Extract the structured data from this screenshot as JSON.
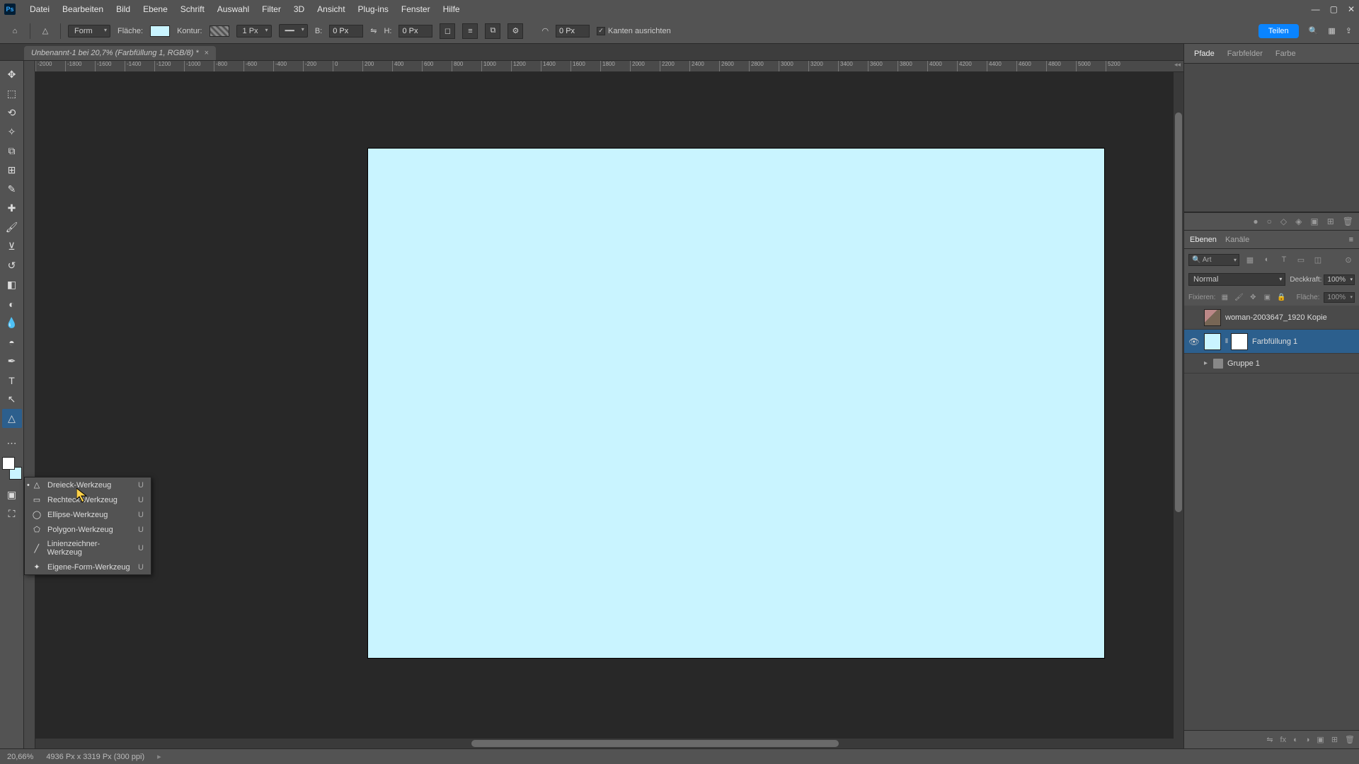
{
  "menubar": [
    "Datei",
    "Bearbeiten",
    "Bild",
    "Ebene",
    "Schrift",
    "Auswahl",
    "Filter",
    "3D",
    "Ansicht",
    "Plug-ins",
    "Fenster",
    "Hilfe"
  ],
  "optbar": {
    "mode_label": "Form",
    "fill_label": "Fläche:",
    "stroke_label": "Kontur:",
    "stroke_width": "1 Px",
    "b_label": "B:",
    "b_val": "0 Px",
    "h_label": "H:",
    "h_val": "0 Px",
    "radius_val": "0 Px",
    "align_edges_label": "Kanten ausrichten",
    "teilen": "Teilen"
  },
  "doctab": {
    "title": "Unbenannt-1 bei 20,7% (Farbfüllung 1, RGB/8) *"
  },
  "ruler_h": [
    "-2000",
    "-1800",
    "-1600",
    "-1400",
    "-1200",
    "-1000",
    "-800",
    "-600",
    "-400",
    "-200",
    "0",
    "200",
    "400",
    "600",
    "800",
    "1000",
    "1200",
    "1400",
    "1600",
    "1800",
    "2000",
    "2200",
    "2400",
    "2600",
    "2800",
    "3000",
    "3200",
    "3400",
    "3600",
    "3800",
    "4000",
    "4200",
    "4400",
    "4600",
    "4800",
    "5000",
    "5200"
  ],
  "flyout": [
    {
      "icon": "△",
      "label": "Dreieck-Werkzeug",
      "key": "U",
      "active": true
    },
    {
      "icon": "▭",
      "label": "Rechteck-Werkzeug",
      "key": "U"
    },
    {
      "icon": "◯",
      "label": "Ellipse-Werkzeug",
      "key": "U"
    },
    {
      "icon": "⬠",
      "label": "Polygon-Werkzeug",
      "key": "U"
    },
    {
      "icon": "╱",
      "label": "Linienzeichner-Werkzeug",
      "key": "U"
    },
    {
      "icon": "✦",
      "label": "Eigene-Form-Werkzeug",
      "key": "U"
    }
  ],
  "pathpanel": {
    "tabs": [
      "Pfade",
      "Farbfelder",
      "Farbe"
    ]
  },
  "layerspanel": {
    "tabs": [
      "Ebenen",
      "Kanäle"
    ],
    "search_label": "Art",
    "blend_mode": "Normal",
    "opacity_label": "Deckkraft:",
    "opacity_val": "100%",
    "lock_label": "Fixieren:",
    "fill_label": "Fläche:",
    "fill_val": "100%",
    "layers": [
      {
        "name": "woman-2003647_1920 Kopie",
        "type": "img",
        "visible": false
      },
      {
        "name": "Farbfüllung 1",
        "type": "fill",
        "visible": true,
        "selected": true
      },
      {
        "name": "Gruppe 1",
        "type": "group",
        "visible": false
      }
    ]
  },
  "status": {
    "zoom": "20,66%",
    "docinfo": "4936 Px x 3319 Px (300 ppi)"
  },
  "colors": {
    "accent": "#0a84ff",
    "canvas": "#c9f4ff"
  }
}
